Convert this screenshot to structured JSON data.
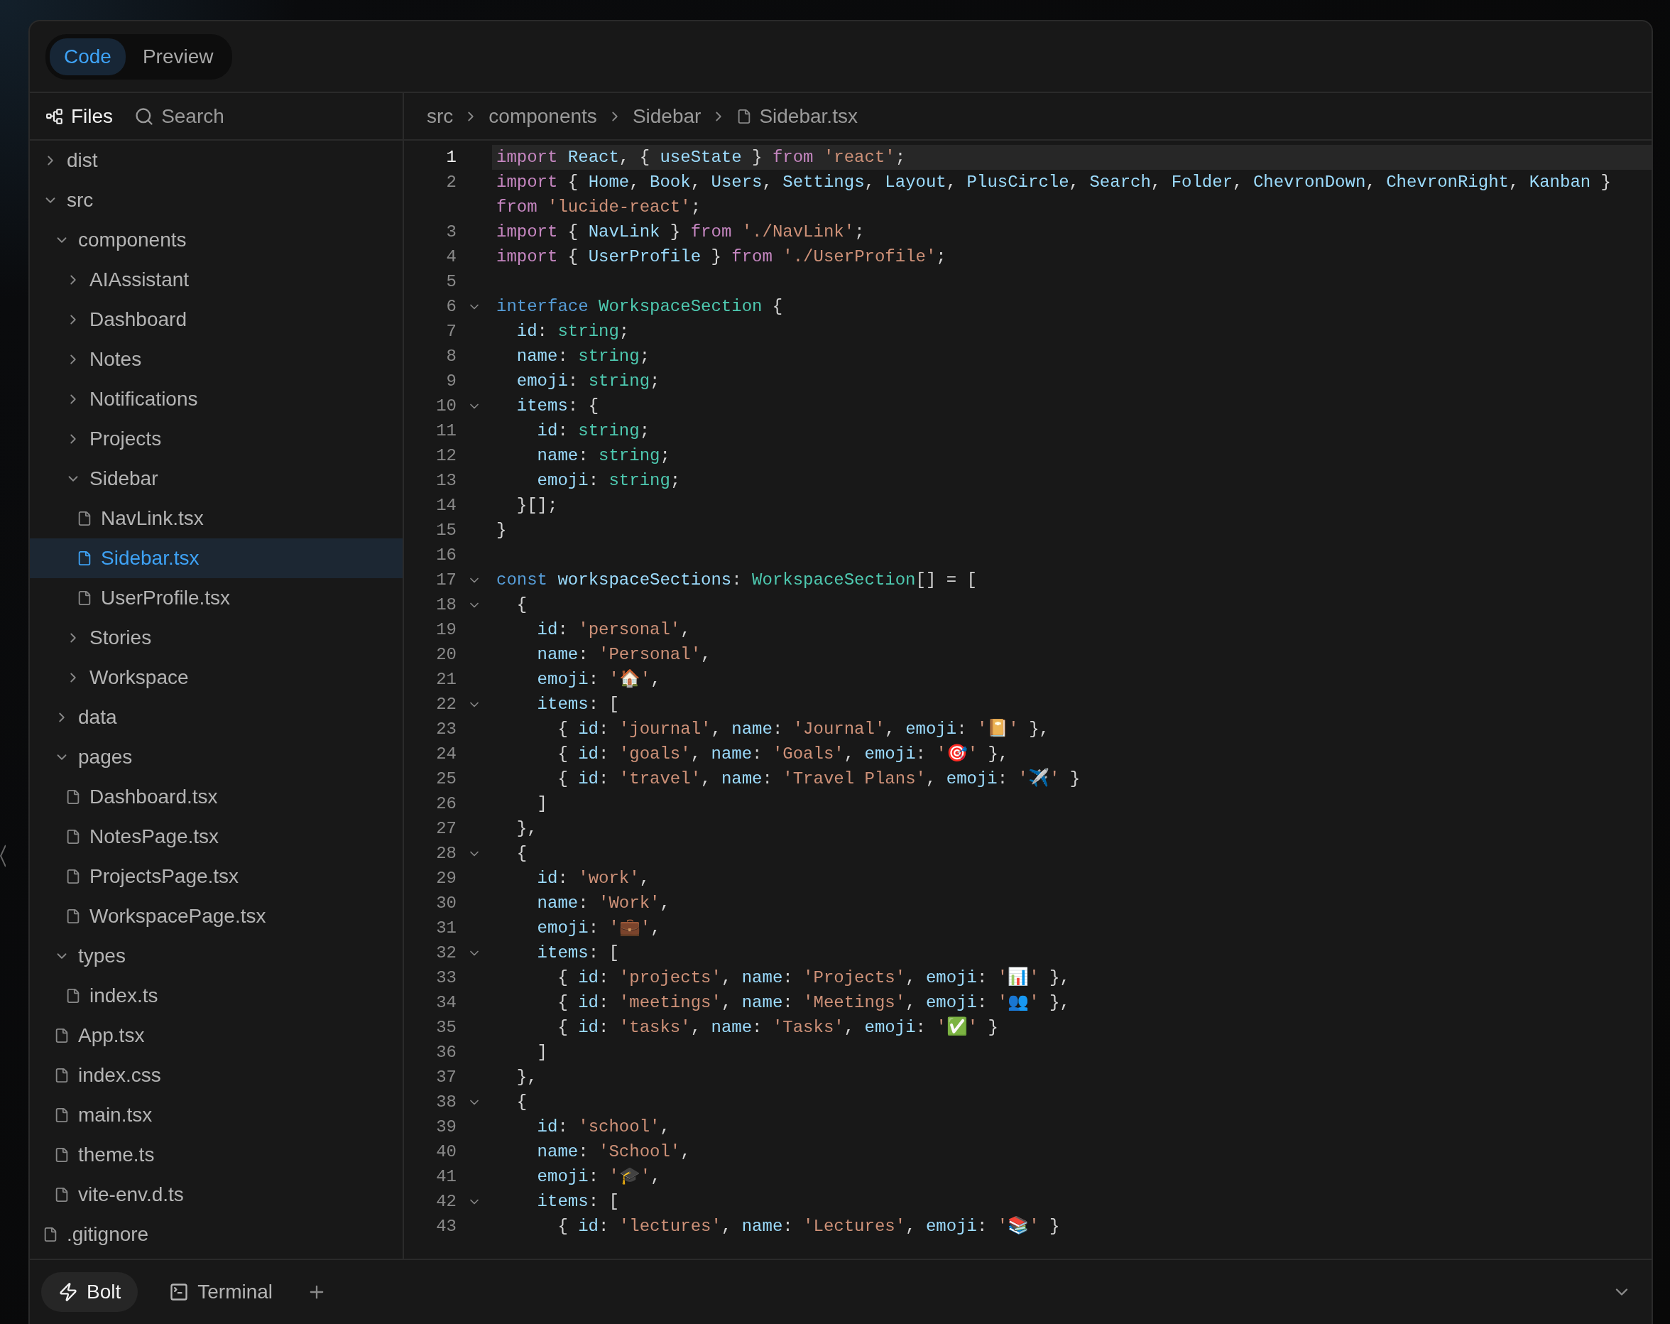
{
  "tabs": [
    {
      "label": "Code",
      "selected": true
    },
    {
      "label": "Preview",
      "selected": false
    }
  ],
  "sidebar": {
    "tabs": [
      {
        "label": "Files",
        "kind": "files",
        "selected": true
      },
      {
        "label": "Search",
        "kind": "search",
        "selected": false
      }
    ],
    "tree": [
      {
        "name": "dist",
        "kind": "folder",
        "expanded": false
      },
      {
        "name": "src",
        "kind": "folder",
        "expanded": true,
        "children": [
          {
            "name": "components",
            "kind": "folder",
            "expanded": true,
            "children": [
              {
                "name": "AIAssistant",
                "kind": "folder",
                "expanded": false
              },
              {
                "name": "Dashboard",
                "kind": "folder",
                "expanded": false
              },
              {
                "name": "Notes",
                "kind": "folder",
                "expanded": false
              },
              {
                "name": "Notifications",
                "kind": "folder",
                "expanded": false
              },
              {
                "name": "Projects",
                "kind": "folder",
                "expanded": false
              },
              {
                "name": "Sidebar",
                "kind": "folder",
                "expanded": true,
                "children": [
                  {
                    "name": "NavLink.tsx",
                    "kind": "file",
                    "selected": false
                  },
                  {
                    "name": "Sidebar.tsx",
                    "kind": "file",
                    "selected": true
                  },
                  {
                    "name": "UserProfile.tsx",
                    "kind": "file",
                    "selected": false
                  }
                ]
              },
              {
                "name": "Stories",
                "kind": "folder",
                "expanded": false
              },
              {
                "name": "Workspace",
                "kind": "folder",
                "expanded": false
              }
            ]
          },
          {
            "name": "data",
            "kind": "folder",
            "expanded": false
          },
          {
            "name": "pages",
            "kind": "folder",
            "expanded": true,
            "children": [
              {
                "name": "Dashboard.tsx",
                "kind": "file",
                "selected": false
              },
              {
                "name": "NotesPage.tsx",
                "kind": "file",
                "selected": false
              },
              {
                "name": "ProjectsPage.tsx",
                "kind": "file",
                "selected": false
              },
              {
                "name": "WorkspacePage.tsx",
                "kind": "file",
                "selected": false
              }
            ]
          },
          {
            "name": "types",
            "kind": "folder",
            "expanded": true,
            "children": [
              {
                "name": "index.ts",
                "kind": "file",
                "selected": false
              }
            ]
          },
          {
            "name": "App.tsx",
            "kind": "file",
            "selected": false
          },
          {
            "name": "index.css",
            "kind": "file",
            "selected": false
          },
          {
            "name": "main.tsx",
            "kind": "file",
            "selected": false
          },
          {
            "name": "theme.ts",
            "kind": "file",
            "selected": false
          },
          {
            "name": "vite-env.d.ts",
            "kind": "file",
            "selected": false
          }
        ]
      },
      {
        "name": ".gitignore",
        "kind": "file",
        "selected": false
      }
    ]
  },
  "breadcrumb": [
    {
      "label": "src",
      "kind": "folder"
    },
    {
      "label": "components",
      "kind": "folder"
    },
    {
      "label": "Sidebar",
      "kind": "folder"
    },
    {
      "label": "Sidebar.tsx",
      "kind": "file"
    }
  ],
  "editor": {
    "lines": [
      {
        "number": "1",
        "active": true,
        "foldable": false,
        "rows": [
          {
            "tokens": [
              {
                "kind": "keyword",
                "text": "import "
              },
              {
                "kind": "ident",
                "text": "React"
              },
              {
                "kind": "plain",
                "text": ", { "
              },
              {
                "kind": "ident",
                "text": "useState"
              },
              {
                "kind": "plain",
                "text": " } "
              },
              {
                "kind": "keyword",
                "text": "from "
              },
              {
                "kind": "string",
                "text": "'react'"
              },
              {
                "kind": "plain",
                "text": ";"
              }
            ]
          }
        ]
      },
      {
        "number": "2",
        "active": false,
        "foldable": false,
        "rows": [
          {
            "tokens": [
              {
                "kind": "keyword",
                "text": "import"
              },
              {
                "kind": "plain",
                "text": " { "
              },
              {
                "kind": "ident",
                "text": "Home"
              },
              {
                "kind": "plain",
                "text": ", "
              },
              {
                "kind": "ident",
                "text": "Book"
              },
              {
                "kind": "plain",
                "text": ", "
              },
              {
                "kind": "ident",
                "text": "Users"
              },
              {
                "kind": "plain",
                "text": ", "
              },
              {
                "kind": "ident",
                "text": "Settings"
              },
              {
                "kind": "plain",
                "text": ", "
              },
              {
                "kind": "ident",
                "text": "Layout"
              },
              {
                "kind": "plain",
                "text": ", "
              },
              {
                "kind": "ident",
                "text": "PlusCircle"
              },
              {
                "kind": "plain",
                "text": ", "
              },
              {
                "kind": "ident",
                "text": "Search"
              },
              {
                "kind": "plain",
                "text": ", "
              },
              {
                "kind": "ident",
                "text": "Folder"
              },
              {
                "kind": "plain",
                "text": ", "
              },
              {
                "kind": "ident",
                "text": "ChevronDown"
              },
              {
                "kind": "plain",
                "text": ", "
              },
              {
                "kind": "ident",
                "text": "ChevronRight"
              },
              {
                "kind": "plain",
                "text": ", "
              },
              {
                "kind": "ident",
                "text": "Kanban"
              },
              {
                "kind": "plain",
                "text": " }"
              }
            ]
          },
          {
            "tokens": [
              {
                "kind": "keyword",
                "text": "from "
              },
              {
                "kind": "string",
                "text": "'lucide-react'"
              },
              {
                "kind": "plain",
                "text": ";"
              }
            ]
          }
        ]
      },
      {
        "number": "3",
        "active": false,
        "foldable": false,
        "rows": [
          {
            "tokens": [
              {
                "kind": "keyword",
                "text": "import"
              },
              {
                "kind": "plain",
                "text": " { "
              },
              {
                "kind": "ident",
                "text": "NavLink"
              },
              {
                "kind": "plain",
                "text": " } "
              },
              {
                "kind": "keyword",
                "text": "from "
              },
              {
                "kind": "string",
                "text": "'./NavLink'"
              },
              {
                "kind": "plain",
                "text": ";"
              }
            ]
          }
        ]
      },
      {
        "number": "4",
        "active": false,
        "foldable": false,
        "rows": [
          {
            "tokens": [
              {
                "kind": "keyword",
                "text": "import"
              },
              {
                "kind": "plain",
                "text": " { "
              },
              {
                "kind": "ident",
                "text": "UserProfile"
              },
              {
                "kind": "plain",
                "text": " } "
              },
              {
                "kind": "keyword",
                "text": "from "
              },
              {
                "kind": "string",
                "text": "'./UserProfile'"
              },
              {
                "kind": "plain",
                "text": ";"
              }
            ]
          }
        ]
      },
      {
        "number": "5",
        "active": false,
        "foldable": false
      },
      {
        "number": "6",
        "active": false,
        "foldable": true,
        "rows": [
          {
            "tokens": [
              {
                "kind": "decl",
                "text": "interface "
              },
              {
                "kind": "type",
                "text": "WorkspaceSection"
              },
              {
                "kind": "plain",
                "text": " {"
              }
            ]
          }
        ]
      },
      {
        "number": "7",
        "active": false,
        "foldable": false,
        "rows": [
          {
            "tokens": [
              {
                "kind": "ident",
                "text": "  id"
              },
              {
                "kind": "plain",
                "text": ": "
              },
              {
                "kind": "type",
                "text": "string"
              },
              {
                "kind": "plain",
                "text": ";"
              }
            ]
          }
        ]
      },
      {
        "number": "8",
        "active": false,
        "foldable": false,
        "rows": [
          {
            "tokens": [
              {
                "kind": "ident",
                "text": "  name"
              },
              {
                "kind": "plain",
                "text": ": "
              },
              {
                "kind": "type",
                "text": "string"
              },
              {
                "kind": "plain",
                "text": ";"
              }
            ]
          }
        ]
      },
      {
        "number": "9",
        "active": false,
        "foldable": false,
        "rows": [
          {
            "tokens": [
              {
                "kind": "ident",
                "text": "  emoji"
              },
              {
                "kind": "plain",
                "text": ": "
              },
              {
                "kind": "type",
                "text": "string"
              },
              {
                "kind": "plain",
                "text": ";"
              }
            ]
          }
        ]
      },
      {
        "number": "10",
        "active": false,
        "foldable": true,
        "rows": [
          {
            "tokens": [
              {
                "kind": "ident",
                "text": "  items"
              },
              {
                "kind": "plain",
                "text": ": {"
              }
            ]
          }
        ]
      },
      {
        "number": "11",
        "active": false,
        "foldable": false,
        "rows": [
          {
            "tokens": [
              {
                "kind": "ident",
                "text": "    id"
              },
              {
                "kind": "plain",
                "text": ": "
              },
              {
                "kind": "type",
                "text": "string"
              },
              {
                "kind": "plain",
                "text": ";"
              }
            ]
          }
        ]
      },
      {
        "number": "12",
        "active": false,
        "foldable": false,
        "rows": [
          {
            "tokens": [
              {
                "kind": "ident",
                "text": "    name"
              },
              {
                "kind": "plain",
                "text": ": "
              },
              {
                "kind": "type",
                "text": "string"
              },
              {
                "kind": "plain",
                "text": ";"
              }
            ]
          }
        ]
      },
      {
        "number": "13",
        "active": false,
        "foldable": false,
        "rows": [
          {
            "tokens": [
              {
                "kind": "ident",
                "text": "    emoji"
              },
              {
                "kind": "plain",
                "text": ": "
              },
              {
                "kind": "type",
                "text": "string"
              },
              {
                "kind": "plain",
                "text": ";"
              }
            ]
          }
        ]
      },
      {
        "number": "14",
        "active": false,
        "foldable": false,
        "rows": [
          {
            "tokens": [
              {
                "kind": "plain",
                "text": "  }[];"
              }
            ]
          }
        ]
      },
      {
        "number": "15",
        "active": false,
        "foldable": false,
        "rows": [
          {
            "tokens": [
              {
                "kind": "plain",
                "text": "}"
              }
            ]
          }
        ]
      },
      {
        "number": "16",
        "active": false,
        "foldable": false
      },
      {
        "number": "17",
        "active": false,
        "foldable": true,
        "rows": [
          {
            "tokens": [
              {
                "kind": "decl",
                "text": "const "
              },
              {
                "kind": "ident",
                "text": "workspaceSections"
              },
              {
                "kind": "plain",
                "text": ": "
              },
              {
                "kind": "type",
                "text": "WorkspaceSection"
              },
              {
                "kind": "plain",
                "text": "[] = ["
              }
            ]
          }
        ]
      },
      {
        "number": "18",
        "active": false,
        "foldable": true,
        "rows": [
          {
            "tokens": [
              {
                "kind": "plain",
                "text": "  {"
              }
            ]
          }
        ]
      },
      {
        "number": "19",
        "active": false,
        "foldable": false,
        "rows": [
          {
            "tokens": [
              {
                "kind": "ident",
                "text": "    id"
              },
              {
                "kind": "plain",
                "text": ": "
              },
              {
                "kind": "string",
                "text": "'personal'"
              },
              {
                "kind": "plain",
                "text": ","
              }
            ]
          }
        ]
      },
      {
        "number": "20",
        "active": false,
        "foldable": false,
        "rows": [
          {
            "tokens": [
              {
                "kind": "ident",
                "text": "    name"
              },
              {
                "kind": "plain",
                "text": ": "
              },
              {
                "kind": "string",
                "text": "'Personal'"
              },
              {
                "kind": "plain",
                "text": ","
              }
            ]
          }
        ]
      },
      {
        "number": "21",
        "active": false,
        "foldable": false,
        "rows": [
          {
            "tokens": [
              {
                "kind": "ident",
                "text": "    emoji"
              },
              {
                "kind": "plain",
                "text": ": "
              },
              {
                "kind": "string",
                "text": "'🏠'"
              },
              {
                "kind": "plain",
                "text": ","
              }
            ]
          }
        ]
      },
      {
        "number": "22",
        "active": false,
        "foldable": true,
        "rows": [
          {
            "tokens": [
              {
                "kind": "ident",
                "text": "    items"
              },
              {
                "kind": "plain",
                "text": ": ["
              }
            ]
          }
        ]
      },
      {
        "number": "23",
        "active": false,
        "foldable": false,
        "rows": [
          {
            "tokens": [
              {
                "kind": "plain",
                "text": "      { "
              },
              {
                "kind": "ident",
                "text": "id"
              },
              {
                "kind": "plain",
                "text": ": "
              },
              {
                "kind": "string",
                "text": "'journal'"
              },
              {
                "kind": "plain",
                "text": ", "
              },
              {
                "kind": "ident",
                "text": "name"
              },
              {
                "kind": "plain",
                "text": ": "
              },
              {
                "kind": "string",
                "text": "'Journal'"
              },
              {
                "kind": "plain",
                "text": ", "
              },
              {
                "kind": "ident",
                "text": "emoji"
              },
              {
                "kind": "plain",
                "text": ": "
              },
              {
                "kind": "string",
                "text": "'📔'"
              },
              {
                "kind": "plain",
                "text": " },"
              }
            ]
          }
        ]
      },
      {
        "number": "24",
        "active": false,
        "foldable": false,
        "rows": [
          {
            "tokens": [
              {
                "kind": "plain",
                "text": "      { "
              },
              {
                "kind": "ident",
                "text": "id"
              },
              {
                "kind": "plain",
                "text": ": "
              },
              {
                "kind": "string",
                "text": "'goals'"
              },
              {
                "kind": "plain",
                "text": ", "
              },
              {
                "kind": "ident",
                "text": "name"
              },
              {
                "kind": "plain",
                "text": ": "
              },
              {
                "kind": "string",
                "text": "'Goals'"
              },
              {
                "kind": "plain",
                "text": ", "
              },
              {
                "kind": "ident",
                "text": "emoji"
              },
              {
                "kind": "plain",
                "text": ": "
              },
              {
                "kind": "string",
                "text": "'🎯'"
              },
              {
                "kind": "plain",
                "text": " },"
              }
            ]
          }
        ]
      },
      {
        "number": "25",
        "active": false,
        "foldable": false,
        "rows": [
          {
            "tokens": [
              {
                "kind": "plain",
                "text": "      { "
              },
              {
                "kind": "ident",
                "text": "id"
              },
              {
                "kind": "plain",
                "text": ": "
              },
              {
                "kind": "string",
                "text": "'travel'"
              },
              {
                "kind": "plain",
                "text": ", "
              },
              {
                "kind": "ident",
                "text": "name"
              },
              {
                "kind": "plain",
                "text": ": "
              },
              {
                "kind": "string",
                "text": "'Travel Plans'"
              },
              {
                "kind": "plain",
                "text": ", "
              },
              {
                "kind": "ident",
                "text": "emoji"
              },
              {
                "kind": "plain",
                "text": ": "
              },
              {
                "kind": "string",
                "text": "'✈️'"
              },
              {
                "kind": "plain",
                "text": " }"
              }
            ]
          }
        ]
      },
      {
        "number": "26",
        "active": false,
        "foldable": false,
        "rows": [
          {
            "tokens": [
              {
                "kind": "plain",
                "text": "    ]"
              }
            ]
          }
        ]
      },
      {
        "number": "27",
        "active": false,
        "foldable": false,
        "rows": [
          {
            "tokens": [
              {
                "kind": "plain",
                "text": "  },"
              }
            ]
          }
        ]
      },
      {
        "number": "28",
        "active": false,
        "foldable": true,
        "rows": [
          {
            "tokens": [
              {
                "kind": "plain",
                "text": "  {"
              }
            ]
          }
        ]
      },
      {
        "number": "29",
        "active": false,
        "foldable": false,
        "rows": [
          {
            "tokens": [
              {
                "kind": "ident",
                "text": "    id"
              },
              {
                "kind": "plain",
                "text": ": "
              },
              {
                "kind": "string",
                "text": "'work'"
              },
              {
                "kind": "plain",
                "text": ","
              }
            ]
          }
        ]
      },
      {
        "number": "30",
        "active": false,
        "foldable": false,
        "rows": [
          {
            "tokens": [
              {
                "kind": "ident",
                "text": "    name"
              },
              {
                "kind": "plain",
                "text": ": "
              },
              {
                "kind": "string",
                "text": "'Work'"
              },
              {
                "kind": "plain",
                "text": ","
              }
            ]
          }
        ]
      },
      {
        "number": "31",
        "active": false,
        "foldable": false,
        "rows": [
          {
            "tokens": [
              {
                "kind": "ident",
                "text": "    emoji"
              },
              {
                "kind": "plain",
                "text": ": "
              },
              {
                "kind": "string",
                "text": "'💼'"
              },
              {
                "kind": "plain",
                "text": ","
              }
            ]
          }
        ]
      },
      {
        "number": "32",
        "active": false,
        "foldable": true,
        "rows": [
          {
            "tokens": [
              {
                "kind": "ident",
                "text": "    items"
              },
              {
                "kind": "plain",
                "text": ": ["
              }
            ]
          }
        ]
      },
      {
        "number": "33",
        "active": false,
        "foldable": false,
        "rows": [
          {
            "tokens": [
              {
                "kind": "plain",
                "text": "      { "
              },
              {
                "kind": "ident",
                "text": "id"
              },
              {
                "kind": "plain",
                "text": ": "
              },
              {
                "kind": "string",
                "text": "'projects'"
              },
              {
                "kind": "plain",
                "text": ", "
              },
              {
                "kind": "ident",
                "text": "name"
              },
              {
                "kind": "plain",
                "text": ": "
              },
              {
                "kind": "string",
                "text": "'Projects'"
              },
              {
                "kind": "plain",
                "text": ", "
              },
              {
                "kind": "ident",
                "text": "emoji"
              },
              {
                "kind": "plain",
                "text": ": "
              },
              {
                "kind": "string",
                "text": "'📊'"
              },
              {
                "kind": "plain",
                "text": " },"
              }
            ]
          }
        ]
      },
      {
        "number": "34",
        "active": false,
        "foldable": false,
        "rows": [
          {
            "tokens": [
              {
                "kind": "plain",
                "text": "      { "
              },
              {
                "kind": "ident",
                "text": "id"
              },
              {
                "kind": "plain",
                "text": ": "
              },
              {
                "kind": "string",
                "text": "'meetings'"
              },
              {
                "kind": "plain",
                "text": ", "
              },
              {
                "kind": "ident",
                "text": "name"
              },
              {
                "kind": "plain",
                "text": ": "
              },
              {
                "kind": "string",
                "text": "'Meetings'"
              },
              {
                "kind": "plain",
                "text": ", "
              },
              {
                "kind": "ident",
                "text": "emoji"
              },
              {
                "kind": "plain",
                "text": ": "
              },
              {
                "kind": "string",
                "text": "'👥'"
              },
              {
                "kind": "plain",
                "text": " },"
              }
            ]
          }
        ]
      },
      {
        "number": "35",
        "active": false,
        "foldable": false,
        "rows": [
          {
            "tokens": [
              {
                "kind": "plain",
                "text": "      { "
              },
              {
                "kind": "ident",
                "text": "id"
              },
              {
                "kind": "plain",
                "text": ": "
              },
              {
                "kind": "string",
                "text": "'tasks'"
              },
              {
                "kind": "plain",
                "text": ", "
              },
              {
                "kind": "ident",
                "text": "name"
              },
              {
                "kind": "plain",
                "text": ": "
              },
              {
                "kind": "string",
                "text": "'Tasks'"
              },
              {
                "kind": "plain",
                "text": ", "
              },
              {
                "kind": "ident",
                "text": "emoji"
              },
              {
                "kind": "plain",
                "text": ": "
              },
              {
                "kind": "string",
                "text": "'✅'"
              },
              {
                "kind": "plain",
                "text": " }"
              }
            ]
          }
        ]
      },
      {
        "number": "36",
        "active": false,
        "foldable": false,
        "rows": [
          {
            "tokens": [
              {
                "kind": "plain",
                "text": "    ]"
              }
            ]
          }
        ]
      },
      {
        "number": "37",
        "active": false,
        "foldable": false,
        "rows": [
          {
            "tokens": [
              {
                "kind": "plain",
                "text": "  },"
              }
            ]
          }
        ]
      },
      {
        "number": "38",
        "active": false,
        "foldable": true,
        "rows": [
          {
            "tokens": [
              {
                "kind": "plain",
                "text": "  {"
              }
            ]
          }
        ]
      },
      {
        "number": "39",
        "active": false,
        "foldable": false,
        "rows": [
          {
            "tokens": [
              {
                "kind": "ident",
                "text": "    id"
              },
              {
                "kind": "plain",
                "text": ": "
              },
              {
                "kind": "string",
                "text": "'school'"
              },
              {
                "kind": "plain",
                "text": ","
              }
            ]
          }
        ]
      },
      {
        "number": "40",
        "active": false,
        "foldable": false,
        "rows": [
          {
            "tokens": [
              {
                "kind": "ident",
                "text": "    name"
              },
              {
                "kind": "plain",
                "text": ": "
              },
              {
                "kind": "string",
                "text": "'School'"
              },
              {
                "kind": "plain",
                "text": ","
              }
            ]
          }
        ]
      },
      {
        "number": "41",
        "active": false,
        "foldable": false,
        "rows": [
          {
            "tokens": [
              {
                "kind": "ident",
                "text": "    emoji"
              },
              {
                "kind": "plain",
                "text": ": "
              },
              {
                "kind": "string",
                "text": "'🎓'"
              },
              {
                "kind": "plain",
                "text": ","
              }
            ]
          }
        ]
      },
      {
        "number": "42",
        "active": false,
        "foldable": true,
        "rows": [
          {
            "tokens": [
              {
                "kind": "ident",
                "text": "    items"
              },
              {
                "kind": "plain",
                "text": ": ["
              }
            ]
          }
        ]
      },
      {
        "number": "43",
        "active": false,
        "foldable": false,
        "rows": [
          {
            "tokens": [
              {
                "kind": "plain",
                "text": "      { "
              },
              {
                "kind": "ident",
                "text": "id"
              },
              {
                "kind": "plain",
                "text": ": "
              },
              {
                "kind": "string",
                "text": "'lectures'"
              },
              {
                "kind": "plain",
                "text": ", "
              },
              {
                "kind": "ident",
                "text": "name"
              },
              {
                "kind": "plain",
                "text": ": "
              },
              {
                "kind": "string",
                "text": "'Lectures'"
              },
              {
                "kind": "plain",
                "text": ", "
              },
              {
                "kind": "ident",
                "text": "emoji"
              },
              {
                "kind": "plain",
                "text": ": "
              },
              {
                "kind": "string",
                "text": "'📚'"
              },
              {
                "kind": "plain",
                "text": " }"
              }
            ]
          }
        ]
      }
    ]
  },
  "bottom_bar": {
    "tabs": [
      {
        "label": "Bolt",
        "kind": "bolt",
        "selected": true
      },
      {
        "label": "Terminal",
        "kind": "terminal",
        "selected": false
      }
    ]
  }
}
